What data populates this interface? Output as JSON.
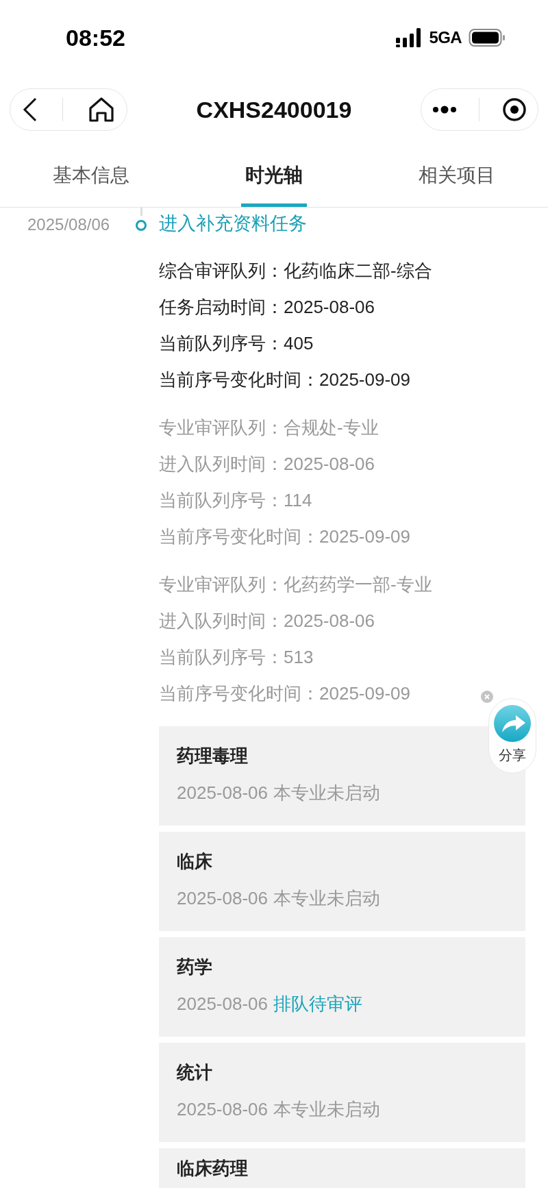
{
  "status_bar": {
    "time": "08:52",
    "network": "5GA"
  },
  "nav": {
    "title": "CXHS2400019"
  },
  "tabs": [
    {
      "label": "基本信息",
      "selected": false
    },
    {
      "label": "时光轴",
      "selected": true
    },
    {
      "label": "相关项目",
      "selected": false
    }
  ],
  "timeline": [
    {
      "date": "2025/08/06",
      "title": "进入补充资料任务",
      "groups": [
        {
          "kind": "main",
          "lines": [
            "综合审评队列：化药临床二部-综合",
            "任务启动时间：2025-08-06",
            "当前队列序号：405",
            "当前序号变化时间：2025-09-09"
          ]
        },
        {
          "kind": "sub",
          "lines": [
            "专业审评队列：合规处-专业",
            "进入队列时间：2025-08-06",
            "当前队列序号：114",
            "当前序号变化时间：2025-09-09"
          ]
        },
        {
          "kind": "sub",
          "lines": [
            "专业审评队列：化药药学一部-专业",
            "进入队列时间：2025-08-06",
            "当前队列序号：513",
            "当前序号变化时间：2025-09-09"
          ]
        }
      ],
      "cards": [
        {
          "title": "药理毒理",
          "date": "2025-08-06",
          "status": "本专业未启动",
          "highlighted": false
        },
        {
          "title": "临床",
          "date": "2025-08-06",
          "status": "本专业未启动",
          "highlighted": false
        },
        {
          "title": "药学",
          "date": "2025-08-06",
          "status": "排队待审评",
          "highlighted": true
        },
        {
          "title": "统计",
          "date": "2025-08-06",
          "status": "本专业未启动",
          "highlighted": false
        },
        {
          "title": "临床药理"
        }
      ]
    }
  ],
  "share": {
    "label": "分享"
  }
}
